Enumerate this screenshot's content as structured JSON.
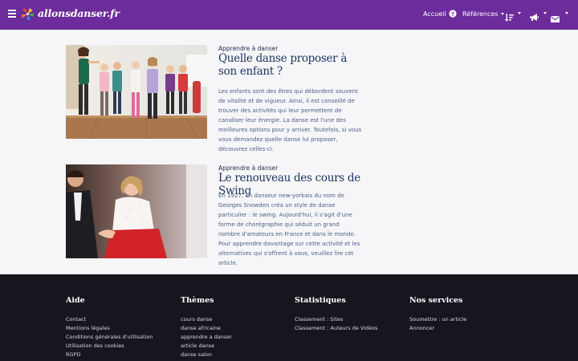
{
  "navbar": {
    "brand": "allonsdanser.fr",
    "links": {
      "home": "Accueil",
      "references": "Références"
    },
    "icons": [
      "menu-icon",
      "help-icon",
      "sort-icon",
      "megaphone-icon",
      "mail-icon"
    ],
    "background_color": "#6c2c9c"
  },
  "articles": [
    {
      "category": "Apprendre à danser",
      "title": "Quelle danse proposer à son enfant ?",
      "excerpt": "Les enfants sont des êtres qui débordent souvent de vitalité et de vigueur. Ainsi, il est conseillé de trouver des activités qui leur permettent de canaliser leur énergie. La danse est l'une des meilleures options pour y arriver. Toutefois, si vous vous demandez quelle danse lui proposer, découvrez celles-ci."
    },
    {
      "category": "Apprendre à danser",
      "title": "Le renouveau des cours de Swing",
      "excerpt": "En 1927, un danseur new-yorkais du nom de Georges Snowden créa un style de danse particulier : le swing. Aujourd'hui, il s'agit d'une forme de chorégraphie qui séduit un grand nombre d'amateurs en France et dans le monde. Pour apprendre davantage sur cette activité et les alternatives qui s'offrent à vous, veuillez lire cet article."
    }
  ],
  "footer": {
    "columns": [
      {
        "title": "Aide",
        "links": [
          "Contact",
          "Mentions légales",
          "Conditions générales d'utilisation",
          "Utilisation des cookies",
          "RGPD"
        ]
      },
      {
        "title": "Thèmes",
        "links": [
          "cours danse",
          "danse africaine",
          "apprendre a danser",
          "article danse",
          "danse salon"
        ]
      },
      {
        "title": "Statistiques",
        "links": [
          "Classement : Sites",
          "Classement : Auteurs de Vidéos"
        ]
      },
      {
        "title": "Nos services",
        "links": [
          "Soumettre : un article",
          "Annoncer"
        ]
      }
    ],
    "background_color": "#16161f"
  }
}
